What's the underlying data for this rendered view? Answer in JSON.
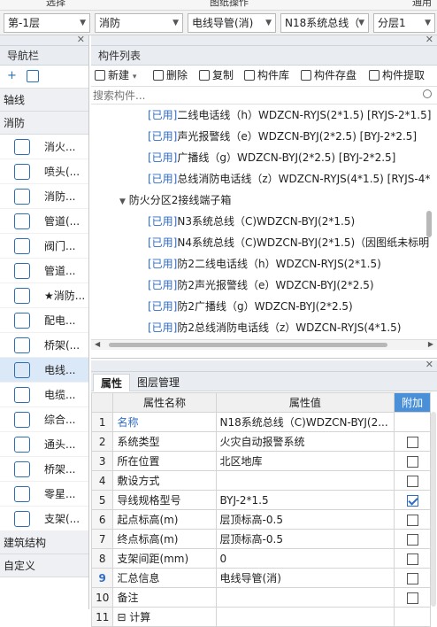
{
  "top_menu": [
    "选择",
    "图纸操作",
    "通用"
  ],
  "combos": [
    {
      "value": "第-1层"
    },
    {
      "value": "消防"
    },
    {
      "value": "电线导管(消)"
    },
    {
      "value": "N18系统总线（"
    },
    {
      "value": "分层1"
    }
  ],
  "nav": {
    "title": "导航栏",
    "sections": [
      "轴线",
      "消防",
      "建筑结构",
      "自定义"
    ],
    "items": [
      {
        "label": "消火...",
        "icon": "fire-hydrant-icon"
      },
      {
        "label": "喷头(...",
        "icon": "sprinkler-icon"
      },
      {
        "label": "消防...",
        "icon": "fire-device-icon"
      },
      {
        "label": "管道(...",
        "icon": "pipe-icon"
      },
      {
        "label": "阀门...",
        "icon": "valve-icon"
      },
      {
        "label": "管道...",
        "icon": "pipe-fitting-icon"
      },
      {
        "label": "★消防...",
        "icon": "fire-alarm-icon"
      },
      {
        "label": "配电...",
        "icon": "distribution-box-icon"
      },
      {
        "label": "桥架(...",
        "icon": "cable-tray-icon"
      },
      {
        "label": "电线...",
        "icon": "wire-conduit-icon"
      },
      {
        "label": "电缆...",
        "icon": "cable-icon"
      },
      {
        "label": "综合...",
        "icon": "combined-icon"
      },
      {
        "label": "通头...",
        "icon": "tee-icon"
      },
      {
        "label": "桥架...",
        "icon": "tray-fitting-icon"
      },
      {
        "label": "零星...",
        "icon": "misc-icon"
      },
      {
        "label": "支架(...",
        "icon": "support-icon"
      }
    ]
  },
  "component_list": {
    "title": "构件列表",
    "toolbar": [
      "新建",
      "删除",
      "复制",
      "构件库",
      "构件存盘",
      "构件提取"
    ],
    "search_placeholder": "搜索构件...",
    "used_tag": "[已用]",
    "rows": [
      {
        "used": true,
        "text": "二线电话线（h）WDZCN-RYJS(2*1.5) [RYJS-2*1.5]"
      },
      {
        "used": true,
        "text": "声光报警线（e）WDZCN-BYJ(2*2.5) [BYJ-2*2.5]"
      },
      {
        "used": true,
        "text": "广播线（g）WDZCN-BYJ(2*2.5) [BYJ-2*2.5]"
      },
      {
        "used": true,
        "text": "总线消防电话线（z）WDZCN-RYJS(4*1.5) [RYJS-4*"
      },
      {
        "used": false,
        "group": true,
        "text": "防火分区2接线端子箱"
      },
      {
        "used": true,
        "text": "N3系统总线（C)WDZCN-BYJ(2*1.5)"
      },
      {
        "used": true,
        "text": "N4系统总线（C)WDZCN-BYJ(2*1.5)（因图纸未标明"
      },
      {
        "used": true,
        "text": "防2二线电话线（h）WDZCN-RYJS(2*1.5)"
      },
      {
        "used": true,
        "text": "防2声光报警线（e）WDZCN-BYJ(2*2.5)"
      },
      {
        "used": true,
        "text": "防2广播线（g）WDZCN-BYJ(2*2.5)"
      },
      {
        "used": true,
        "text": "防2总线消防电话线（z）WDZCN-RYJS(4*1.5)"
      }
    ]
  },
  "properties": {
    "tabs": [
      "属性",
      "图层管理"
    ],
    "headers": [
      "属性名称",
      "属性值",
      "附加"
    ],
    "rows": [
      {
        "num": "1",
        "name": "名称",
        "value": "N18系统总线（C)WDZCN-BYJ(2...",
        "blue": true,
        "cb": null
      },
      {
        "num": "2",
        "name": "系统类型",
        "value": "火灾自动报警系统",
        "blue": false,
        "cb": false
      },
      {
        "num": "3",
        "name": "所在位置",
        "value": "北区地库",
        "blue": false,
        "cb": false
      },
      {
        "num": "4",
        "name": "敷设方式",
        "value": "",
        "blue": false,
        "cb": false
      },
      {
        "num": "5",
        "name": "导线规格型号",
        "value": "BYJ-2*1.5",
        "blue": false,
        "cb": true
      },
      {
        "num": "6",
        "name": "起点标高(m)",
        "value": "层顶标高-0.5",
        "blue": false,
        "cb": false
      },
      {
        "num": "7",
        "name": "终点标高(m)",
        "value": "层顶标高-0.5",
        "blue": false,
        "cb": false
      },
      {
        "num": "8",
        "name": "支架间距(mm)",
        "value": "0",
        "blue": false,
        "cb": false
      },
      {
        "num": "9",
        "name": "汇总信息",
        "value": "电线导管(消)",
        "blue": false,
        "cb": false
      },
      {
        "num": "10",
        "name": "备注",
        "value": "",
        "blue": false,
        "cb": false
      },
      {
        "num": "11",
        "name": "⊟ 计算",
        "value": "",
        "blue": false,
        "cb": null
      }
    ]
  },
  "colors": {
    "accent": "#2f6cc4",
    "header_bg": "#e9ecf0"
  }
}
